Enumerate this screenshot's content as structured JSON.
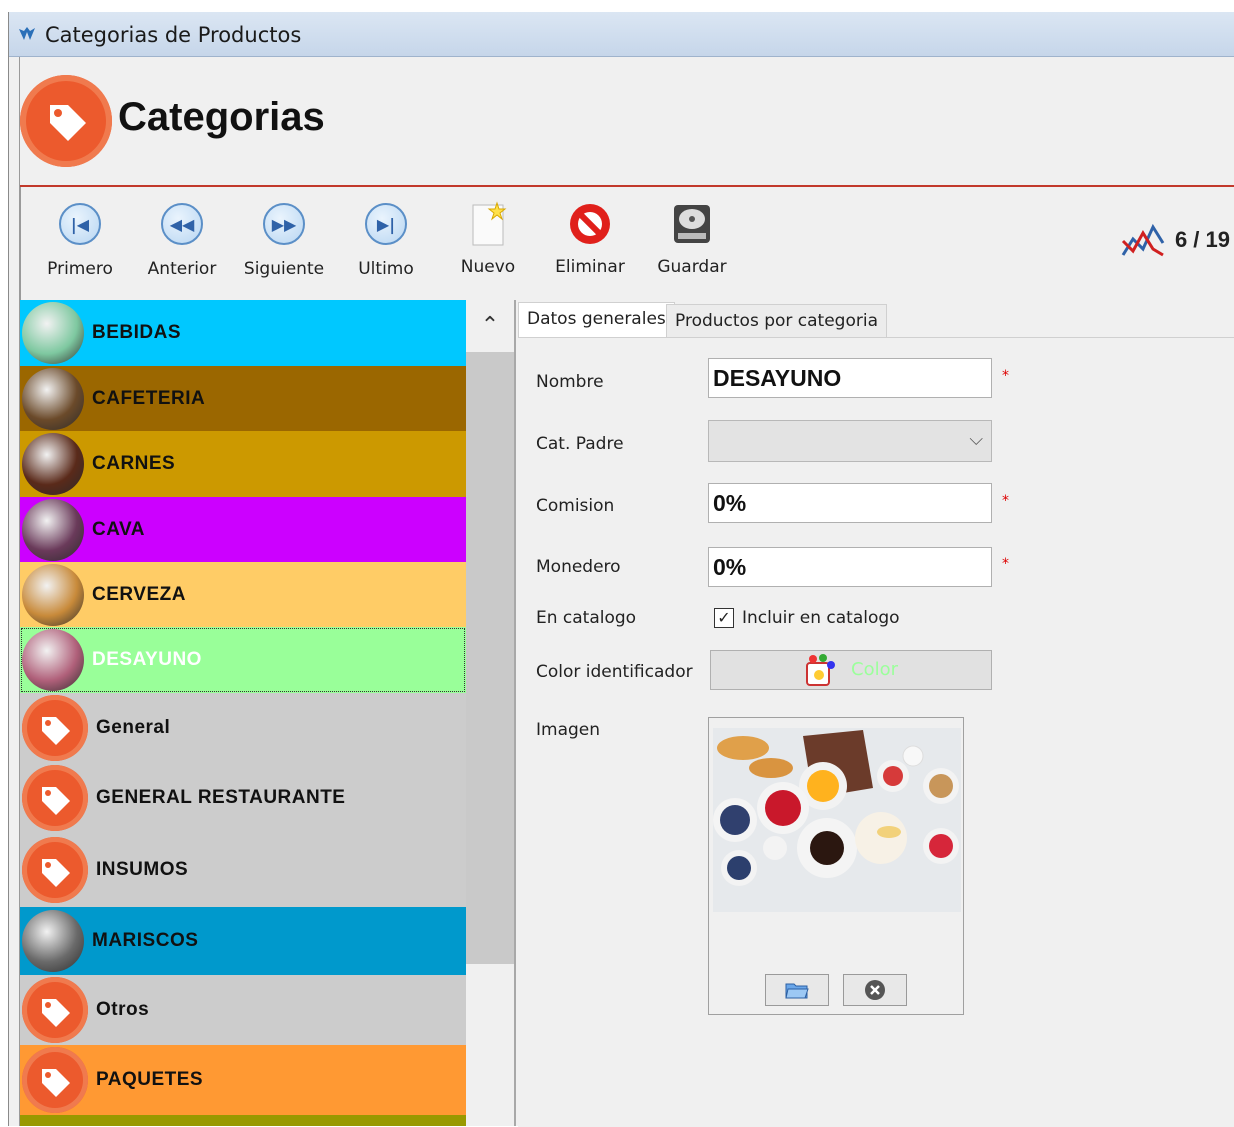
{
  "window": {
    "title": "Categorias de Productos"
  },
  "header": {
    "title": "Categorias"
  },
  "toolbar": {
    "first": "Primero",
    "previous": "Anterior",
    "next": "Siguiente",
    "last": "Ultimo",
    "new": "Nuevo",
    "delete": "Eliminar",
    "save": "Guardar",
    "counter": "6 / 19"
  },
  "categories": [
    {
      "name": "BEBIDAS",
      "color": "#00c8ff",
      "selected": false
    },
    {
      "name": "CAFETERIA",
      "color": "#9b6700",
      "selected": false
    },
    {
      "name": "CARNES",
      "color": "#cc9900",
      "selected": false
    },
    {
      "name": "CAVA",
      "color": "#cc00ff",
      "selected": false
    },
    {
      "name": "CERVEZA",
      "color": "#ffcc66",
      "selected": false
    },
    {
      "name": "DESAYUNO",
      "color": "#99ff99",
      "selected": true
    },
    {
      "name": "General",
      "color": "#cccccc",
      "selected": false
    },
    {
      "name": "GENERAL RESTAURANTE",
      "color": "#cccccc",
      "selected": false
    },
    {
      "name": "INSUMOS",
      "color": "#cccccc",
      "selected": false
    },
    {
      "name": "MARISCOS",
      "color": "#0099cc",
      "selected": false
    },
    {
      "name": "Otros",
      "color": "#cccccc",
      "selected": false
    },
    {
      "name": "PAQUETES",
      "color": "#ff9933",
      "selected": false
    }
  ],
  "tabs": [
    "Datos generales",
    "Productos por categoria"
  ],
  "form": {
    "nombre_label": "Nombre",
    "nombre_value": "DESAYUNO",
    "cat_padre_label": "Cat. Padre",
    "cat_padre_value": "",
    "comision_label": "Comision",
    "comision_value": "0%",
    "monedero_label": "Monedero",
    "monedero_value": "0%",
    "en_catalogo_label": "En catalogo",
    "incluir_label": "Incluir en catalogo",
    "incluir_checked": true,
    "color_label": "Color identificador",
    "color_button": "Color",
    "imagen_label": "Imagen",
    "required_mark": "*"
  }
}
